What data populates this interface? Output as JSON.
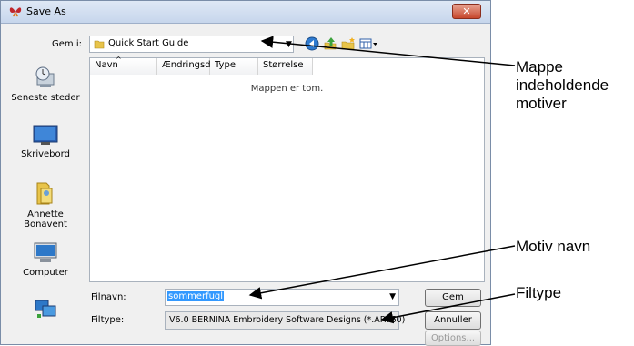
{
  "window": {
    "title": "Save As",
    "close_label": "✕"
  },
  "toolbar": {
    "save_in_label": "Gem i:",
    "current_folder": "Quick Start Guide"
  },
  "places": [
    {
      "label": "Seneste steder",
      "icon": "recent-places-icon"
    },
    {
      "label": "Skrivebord",
      "icon": "desktop-icon"
    },
    {
      "label": "Annette\nBonavent",
      "icon": "user-folder-icon"
    },
    {
      "label": "Computer",
      "icon": "computer-icon"
    },
    {
      "label": "",
      "icon": "network-icon"
    }
  ],
  "file_list": {
    "columns": [
      "Navn",
      "Ændringsd...",
      "Type",
      "Størrelse"
    ],
    "empty_message": "Mappen er tom."
  },
  "form": {
    "filename_label": "Filnavn:",
    "filename_value": "sommerfugl",
    "filetype_label": "Filtype:",
    "filetype_value": "V6.0 BERNINA Embroidery Software Designs (*.ART60)",
    "save_button": "Gem",
    "cancel_button": "Annuller",
    "options_button": "Options..."
  },
  "annotations": {
    "folder": "Mappe\nindeholdende\nmotiver",
    "motif_name": "Motiv navn",
    "file_type": "Filtype"
  }
}
